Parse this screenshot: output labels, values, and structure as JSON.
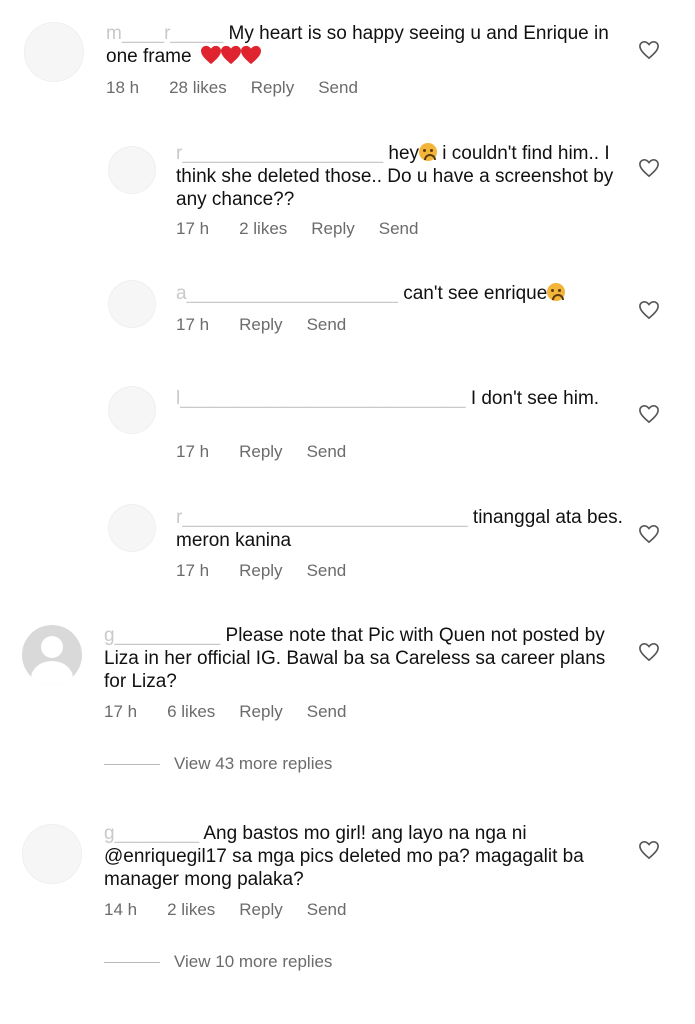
{
  "comments": [
    {
      "username": "m____r_____",
      "text": "My heart is so happy seeing u and Enrique in one frame",
      "time": "18 h",
      "likes": "28 likes",
      "reply": "Reply",
      "send": "Send"
    },
    {
      "username": "r___________________",
      "text_a": " hey",
      "text_b": " i couldn't find him.. I think she deleted those.. Do u have a screenshot by any chance??",
      "time": "17 h",
      "likes": "2 likes",
      "reply": "Reply",
      "send": "Send"
    },
    {
      "username": "a____________________",
      "text": "can't see enrique",
      "time": "17 h",
      "reply": "Reply",
      "send": "Send"
    },
    {
      "username": "l___________________________",
      "text": "I don't see him.",
      "time": "17 h",
      "reply": "Reply",
      "send": "Send"
    },
    {
      "username": "r___________________________",
      "text": "tinanggal ata bes. meron kanina",
      "time": "17 h",
      "reply": "Reply",
      "send": "Send"
    },
    {
      "username": "g__________",
      "text": "Please note that Pic with Quen not posted by Liza in her official IG. Bawal ba sa Careless sa career plans for Liza?",
      "time": "17 h",
      "likes": "6 likes",
      "reply": "Reply",
      "send": "Send",
      "view_replies": "View 43 more replies"
    },
    {
      "username": "g________",
      "text_a": "Ang bastos mo girl! ang layo na nga ni ",
      "mention": "@enriquegil17",
      "text_b": " sa mga pics deleted mo pa? magagalit ba manager mong palaka?",
      "time": "14 h",
      "likes": "2 likes",
      "reply": "Reply",
      "send": "Send",
      "view_replies": "View 10 more replies"
    }
  ],
  "icons": {
    "like": "heart-outline-icon",
    "emoji_sad": "sad-face-emoji",
    "emoji_heart": "red-heart-emoji"
  },
  "colors": {
    "heart_red": "#e0242f",
    "meta_gray": "#6b6b6b"
  }
}
